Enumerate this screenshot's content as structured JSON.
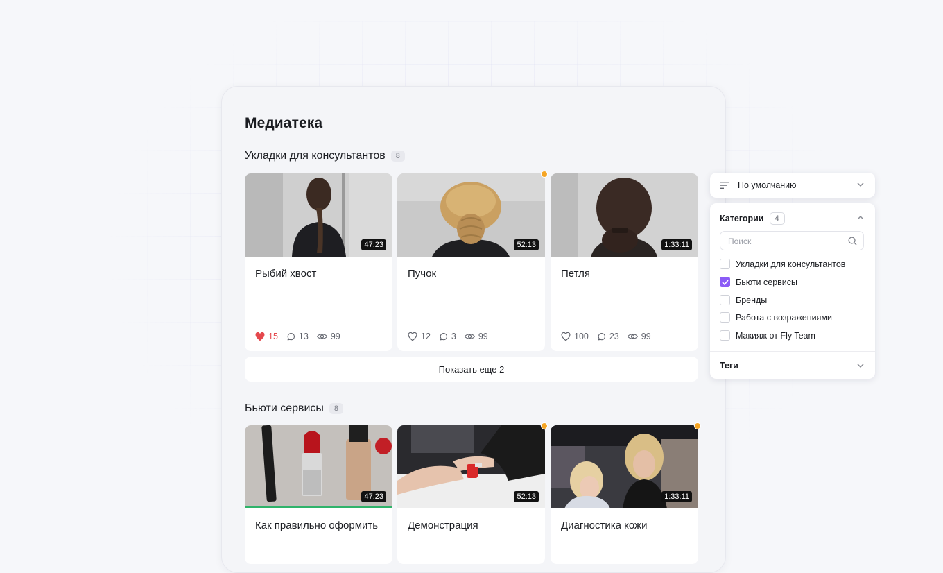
{
  "page": {
    "title": "Медиатека"
  },
  "sections": [
    {
      "title": "Укладки для консультантов",
      "count": "8",
      "cards": [
        {
          "title": "Рыбий хвост",
          "duration": "47:23",
          "likes": "15",
          "comments": "13",
          "views": "99",
          "liked": true
        },
        {
          "title": "Пучок",
          "duration": "52:13",
          "likes": "12",
          "comments": "3",
          "views": "99",
          "liked": false
        },
        {
          "title": "Петля",
          "duration": "1:33:11",
          "likes": "100",
          "comments": "23",
          "views": "99",
          "liked": false
        }
      ],
      "show_more_label": "Показать еще 2"
    },
    {
      "title": "Бьюти сервисы",
      "count": "8",
      "cards": [
        {
          "title": "Как правильно оформить",
          "duration": "47:23",
          "progress": 1.0
        },
        {
          "title": "Демонстрация",
          "duration": "52:13"
        },
        {
          "title": "Диагностика кожи",
          "duration": "1:33:11"
        }
      ]
    }
  ],
  "sort": {
    "label": "По умолчанию"
  },
  "filters": {
    "categories_label": "Категории",
    "categories_count": "4",
    "search_placeholder": "Поиск",
    "items": [
      {
        "label": "Укладки для консультантов",
        "checked": false
      },
      {
        "label": "Бьюти сервисы",
        "checked": true
      },
      {
        "label": "Бренды",
        "checked": false
      },
      {
        "label": "Работа с возражениями",
        "checked": false
      },
      {
        "label": "Макияж от Fly Team",
        "checked": false
      }
    ],
    "tags_label": "Теги"
  },
  "colors": {
    "accent": "#8b5cf6",
    "like": "#e5484d",
    "new_dot": "#f5a524",
    "progress": "#2fb36a"
  }
}
